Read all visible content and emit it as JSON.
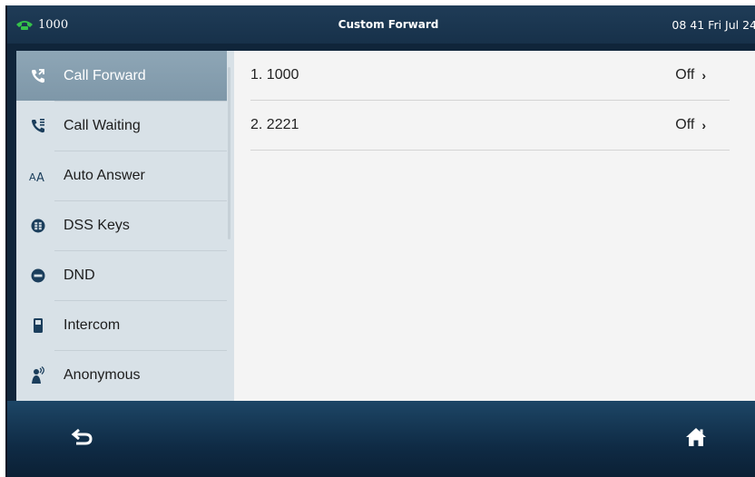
{
  "status_bar": {
    "line": "1000",
    "title": "Custom Forward",
    "datetime": "08 41 Fri Jul 24"
  },
  "sidebar": {
    "items": [
      {
        "label": "Call Forward",
        "icon": "call-forward-icon",
        "selected": true
      },
      {
        "label": "Call Waiting",
        "icon": "call-waiting-icon",
        "selected": false
      },
      {
        "label": "Auto Answer",
        "icon": "auto-answer-icon",
        "selected": false
      },
      {
        "label": "DSS Keys",
        "icon": "dss-keys-icon",
        "selected": false
      },
      {
        "label": "DND",
        "icon": "dnd-icon",
        "selected": false
      },
      {
        "label": "Intercom",
        "icon": "intercom-icon",
        "selected": false
      },
      {
        "label": "Anonymous",
        "icon": "anonymous-icon",
        "selected": false
      }
    ]
  },
  "main": {
    "rows": [
      {
        "label": "1. 1000",
        "value": "Off"
      },
      {
        "label": "2. 2221",
        "value": "Off"
      }
    ]
  },
  "bottom_bar": {
    "back_icon": "back-arrow-icon",
    "home_icon": "home-icon"
  },
  "colors": {
    "status_bar": "#1f3c57",
    "sidebar_bg": "#d8e1e7",
    "sidebar_selected": "#869fb0",
    "line_icon_green": "#35c24a",
    "bottom_bar": "#163a58"
  }
}
